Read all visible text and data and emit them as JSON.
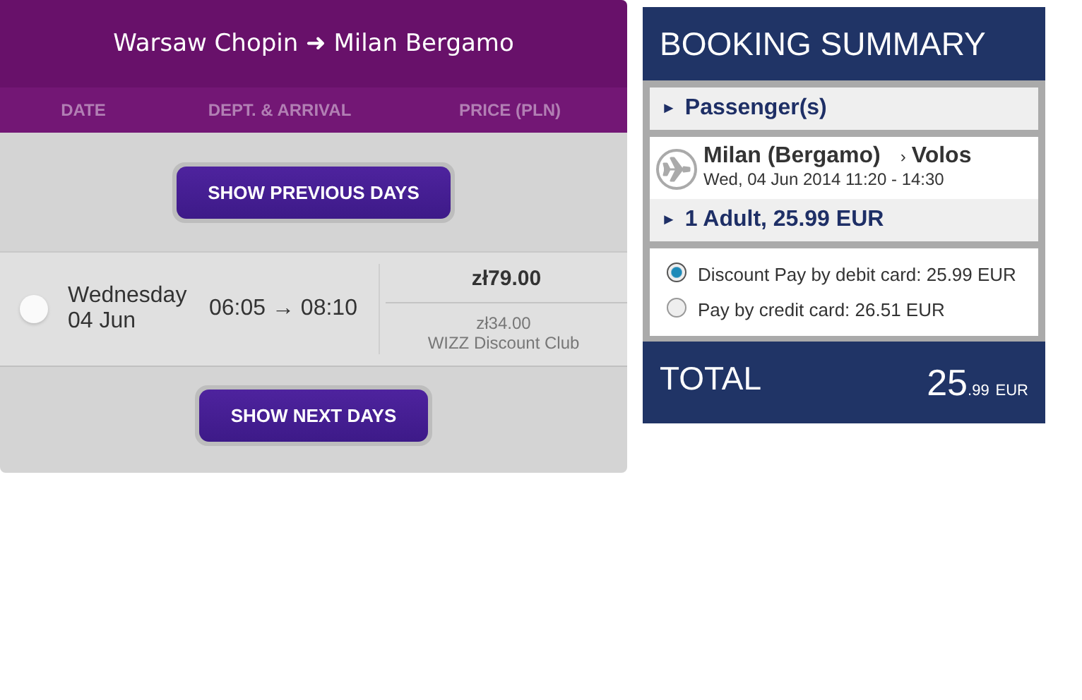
{
  "flights": {
    "title": "Warsaw Chopin ➜ Milan Bergamo",
    "columns": [
      "DATE",
      "DEPT. & ARRIVAL",
      "PRICE (PLN)"
    ],
    "previous_button": "SHOW PREVIOUS DAYS",
    "rows": [
      {
        "selected": false,
        "weekday": "Wednesday",
        "date": "04 Jun",
        "times": "06:05 → 08:10",
        "price": "zł79.00",
        "club_price": "zł34.00",
        "club_label": "WIZZ Discount Club"
      }
    ],
    "next_button": "SHOW NEXT DAYS"
  },
  "summary": {
    "title": "BOOKING SUMMARY",
    "passengers": {
      "marker": "►",
      "label": "Passenger(s)"
    },
    "segment": {
      "origin": "Milan (Bergamo)",
      "separator": "›",
      "destination": "Volos",
      "datetime": "Wed, 04 Jun 2014 11:20 - 14:30"
    },
    "fare": {
      "marker": "►",
      "label": "1 Adult, 25.99 EUR"
    },
    "payments": [
      {
        "selected": true,
        "label": "Discount Pay by debit card: 25.99 EUR"
      },
      {
        "selected": false,
        "label": "Pay by credit card: 26.51 EUR"
      }
    ],
    "total": {
      "label": "TOTAL",
      "main": "25",
      "fraction": ".99",
      "currency": "EUR"
    }
  }
}
